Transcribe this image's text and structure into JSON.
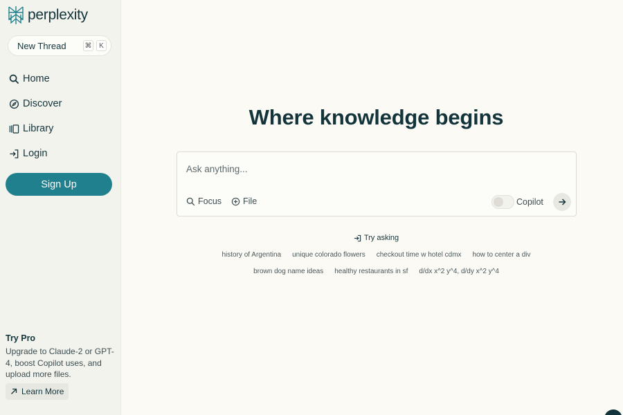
{
  "brand": {
    "name": "perplexity",
    "accent": "#20808d",
    "text_color": "#13343b"
  },
  "sidebar": {
    "new_thread": {
      "label": "New Thread",
      "shortcut_keys": [
        "⌘",
        "K"
      ]
    },
    "nav": [
      {
        "label": "Home",
        "icon": "search-icon"
      },
      {
        "label": "Discover",
        "icon": "compass-icon"
      },
      {
        "label": "Library",
        "icon": "library-icon"
      },
      {
        "label": "Login",
        "icon": "login-icon"
      }
    ],
    "signup_label": "Sign Up",
    "pro": {
      "title": "Try Pro",
      "description": "Upgrade to Claude-2 or GPT-4, boost Copilot uses, and upload more files.",
      "learn_more": "Learn More"
    }
  },
  "main": {
    "headline": "Where knowledge begins",
    "search": {
      "placeholder": "Ask anything...",
      "focus_label": "Focus",
      "file_label": "File",
      "copilot_label": "Copilot",
      "copilot_on": false
    },
    "try_asking_label": "Try asking",
    "suggestions_row1": [
      "history of Argentina",
      "unique colorado flowers",
      "checkout time w hotel cdmx",
      "how to center a div"
    ],
    "suggestions_row2": [
      "brown dog name ideas",
      "healthy restaurants in sf",
      "d/dx x^2 y^4, d/dy x^2 y^4"
    ]
  }
}
